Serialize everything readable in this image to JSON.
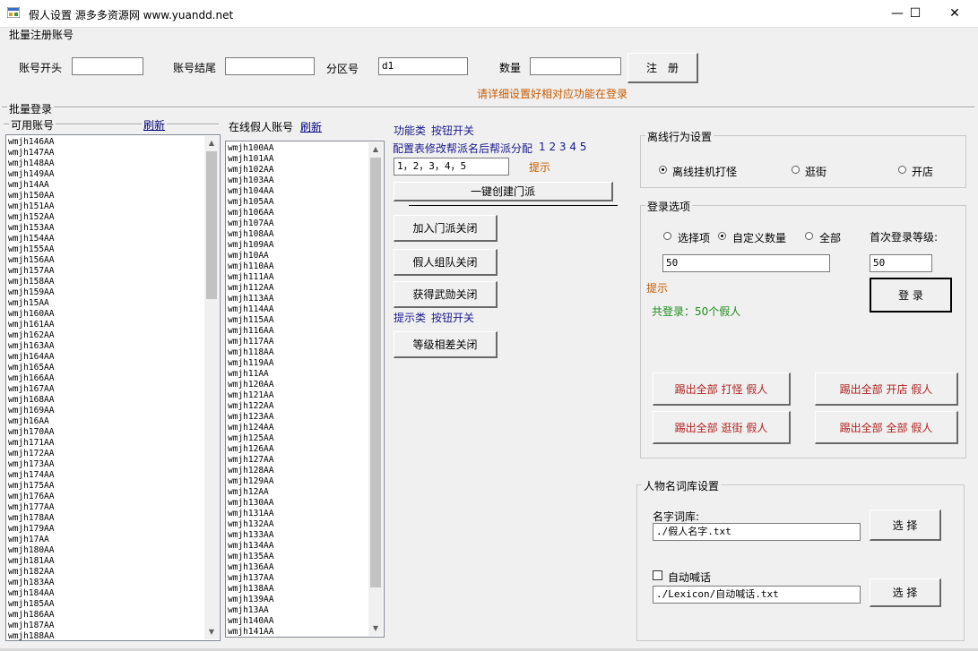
{
  "window": {
    "title": "假人设置 源多多资源网 www.yuandd.net",
    "minimize": "—",
    "maximize": "☐",
    "close": "✕"
  },
  "batch_register": {
    "title": "批量注册账号",
    "account_start_label": "账号开头",
    "account_start_value": "",
    "account_end_label": "账号结尾",
    "account_end_value": "",
    "zone_label": "分区号",
    "zone_value": "d1",
    "count_label": "数量",
    "count_value": "",
    "register_button": "注　册",
    "hint": "请详细设置好相对应功能在登录"
  },
  "batch_login": {
    "title": "批量登录",
    "available_label": "可用账号",
    "available_refresh": "刷新",
    "available_accounts": [
      "wmjh146AA",
      "wmjh147AA",
      "wmjh148AA",
      "wmjh149AA",
      "wmjh14AA",
      "wmjh150AA",
      "wmjh151AA",
      "wmjh152AA",
      "wmjh153AA",
      "wmjh154AA",
      "wmjh155AA",
      "wmjh156AA",
      "wmjh157AA",
      "wmjh158AA",
      "wmjh159AA",
      "wmjh15AA",
      "wmjh160AA",
      "wmjh161AA",
      "wmjh162AA",
      "wmjh163AA",
      "wmjh164AA",
      "wmjh165AA",
      "wmjh166AA",
      "wmjh167AA",
      "wmjh168AA",
      "wmjh169AA",
      "wmjh16AA",
      "wmjh170AA",
      "wmjh171AA",
      "wmjh172AA",
      "wmjh173AA",
      "wmjh174AA",
      "wmjh175AA",
      "wmjh176AA",
      "wmjh177AA",
      "wmjh178AA",
      "wmjh179AA",
      "wmjh17AA",
      "wmjh180AA",
      "wmjh181AA",
      "wmjh182AA",
      "wmjh183AA",
      "wmjh184AA",
      "wmjh185AA",
      "wmjh186AA",
      "wmjh187AA",
      "wmjh188AA"
    ],
    "online_label": "在线假人账号",
    "online_refresh": "刷新",
    "online_accounts": [
      "wmjh100AA",
      "wmjh101AA",
      "wmjh102AA",
      "wmjh103AA",
      "wmjh104AA",
      "wmjh105AA",
      "wmjh106AA",
      "wmjh107AA",
      "wmjh108AA",
      "wmjh109AA",
      "wmjh10AA",
      "wmjh110AA",
      "wmjh111AA",
      "wmjh112AA",
      "wmjh113AA",
      "wmjh114AA",
      "wmjh115AA",
      "wmjh116AA",
      "wmjh117AA",
      "wmjh118AA",
      "wmjh119AA",
      "wmjh11AA",
      "wmjh120AA",
      "wmjh121AA",
      "wmjh122AA",
      "wmjh123AA",
      "wmjh124AA",
      "wmjh125AA",
      "wmjh126AA",
      "wmjh127AA",
      "wmjh128AA",
      "wmjh129AA",
      "wmjh12AA",
      "wmjh130AA",
      "wmjh131AA",
      "wmjh132AA",
      "wmjh133AA",
      "wmjh134AA",
      "wmjh135AA",
      "wmjh136AA",
      "wmjh137AA",
      "wmjh138AA",
      "wmjh139AA",
      "wmjh13AA",
      "wmjh140AA",
      "wmjh141AA"
    ]
  },
  "function_panel": {
    "function_label": "功能类",
    "toggle_label": "按钮开关",
    "config_label": "配置表修改帮派名后帮派分配",
    "config_nums": "1 2 3 4 5",
    "config_value": "1，2，3，4，5",
    "config_hint": "提示",
    "create_sect_button": "一键创建门派",
    "join_sect_button": "加入门派关闭",
    "team_button": "假人组队关闭",
    "medal_button": "获得武勋关闭",
    "hint_label": "提示类",
    "hint_toggle_label": "按钮开关",
    "level_diff_button": "等级相差关闭"
  },
  "offline_behavior": {
    "title": "离线行为设置",
    "options": [
      "离线挂机打怪",
      "逛街",
      "开店"
    ],
    "selected": 0
  },
  "login_options": {
    "title": "登录选项",
    "options": [
      "选择项",
      "自定义数量",
      "全部"
    ],
    "selected": 1,
    "first_level_label": "首次登录等级:",
    "count_value": "50",
    "level_value": "50",
    "hint": "提示",
    "login_button": "登 录",
    "total_login": "共登录：50个假人",
    "kick_fight": "踢出全部 打怪 假人",
    "kick_shop": "踢出全部 开店 假人",
    "kick_stroll": "踢出全部 逛街 假人",
    "kick_all": "踢出全部 全部 假人"
  },
  "name_library": {
    "title": "人物名词库设置",
    "name_lib_label": "名字词库:",
    "name_lib_path": "./假人名字.txt",
    "select_button": "选 择",
    "auto_shout_label": "自动喊话",
    "auto_shout_checked": false,
    "auto_shout_path": "./Lexicon/自动喊话.txt",
    "select_button_2": "选 择"
  },
  "colors": {
    "window_bg": "#f0f0f0",
    "hint_orange": "#c85a00",
    "kick_red": "#b22222",
    "link_blue": "#1a1a8c",
    "green_text": "#1d8c1d"
  }
}
